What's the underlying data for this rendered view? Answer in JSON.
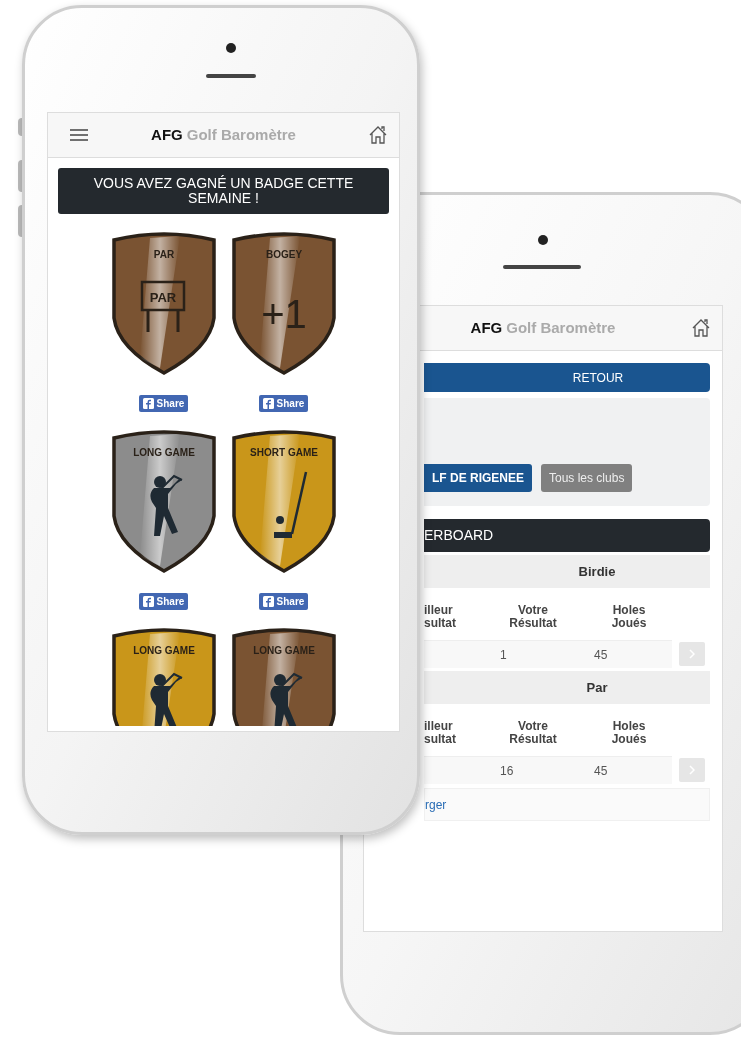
{
  "front_phone": {
    "header": {
      "brand": "AFG",
      "title": "Golf Baromètre"
    },
    "banner": "VOUS AVEZ GAGNÉ UN BADGE CETTE SEMAINE !",
    "badges": [
      {
        "label": "PAR",
        "color": "#7a5332",
        "kind": "sign",
        "emblem_text": "PAR",
        "share": "Share"
      },
      {
        "label": "BOGEY",
        "color": "#7a5332",
        "kind": "number",
        "emblem_text": "+1",
        "share": "Share"
      },
      {
        "label": "LONG GAME",
        "color": "#8c8c8c",
        "kind": "golfer",
        "share": "Share"
      },
      {
        "label": "SHORT GAME",
        "color": "#c9961a",
        "kind": "putter",
        "share": "Share"
      },
      {
        "label": "LONG GAME",
        "color": "#c9961a",
        "kind": "golfer"
      },
      {
        "label": "LONG GAME",
        "color": "#7a5332",
        "kind": "golfer"
      }
    ]
  },
  "back_phone": {
    "header": {
      "brand": "AFG",
      "title": "Golf Baromètre"
    },
    "back_button": "RETOUR",
    "club_filters": [
      {
        "label": "LF DE RIGENEE",
        "selected": true
      },
      {
        "label": "Tous les clubs",
        "selected": false
      }
    ],
    "section_title": "ERBOARD",
    "groups": [
      {
        "title": "Birdie",
        "columns": [
          "illeur\nsultat",
          "Votre\nRésultat",
          "Holes\nJoués"
        ],
        "cells": [
          "1",
          "45"
        ]
      },
      {
        "title": "Par",
        "columns": [
          "illeur\nsultat",
          "Votre\nRésultat",
          "Holes\nJoués"
        ],
        "cells": [
          "16",
          "45"
        ]
      }
    ],
    "more_link": "rger"
  }
}
